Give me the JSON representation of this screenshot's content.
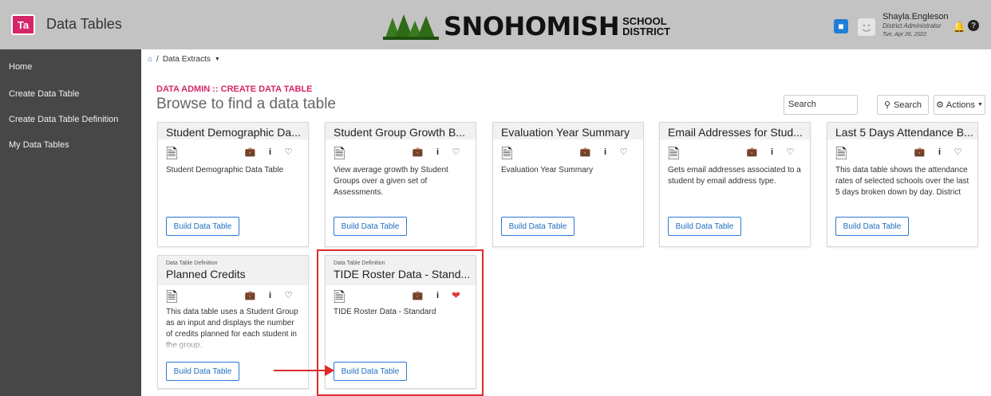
{
  "app": {
    "icon_text": "Ta",
    "title": "Data Tables"
  },
  "logo": {
    "name": "SNOHOMISH",
    "sub1": "SCHOOL",
    "sub2": "DISTRICT"
  },
  "user": {
    "name": "Shayla.Engleson",
    "role": "District Administrator",
    "date": "Tue, Apr 26, 2022"
  },
  "sidebar": {
    "items": [
      {
        "label": "Home"
      },
      {
        "label": "Create Data Table"
      },
      {
        "label": "Create Data Table Definition"
      },
      {
        "label": "My Data Tables"
      }
    ]
  },
  "breadcrumb": {
    "item": "Data Extracts"
  },
  "header": {
    "section": "DATA ADMIN :: CREATE DATA TABLE",
    "title": "Browse to find a data table"
  },
  "search": {
    "value": "Search",
    "button": "Search",
    "actions": "Actions"
  },
  "cards": [
    {
      "title": "Student Demographic Da...",
      "desc": "Student Demographic Data Table",
      "build": "Build Data Table"
    },
    {
      "title": "Student Group Growth B...",
      "desc": "View average growth by Student Groups over a given set of Assessments.",
      "build": "Build Data Table"
    },
    {
      "title": "Evaluation Year Summary",
      "desc": "Evaluation Year Summary",
      "build": "Build Data Table"
    },
    {
      "title": "Email Addresses for Stud...",
      "desc": "Gets email addresses associated to a student by email address type.",
      "build": "Build Data Table"
    },
    {
      "title": "Last 5 Days Attendance B...",
      "desc": "This data table shows the attendance rates of selected schools over the last 5 days broken down by day. District",
      "build": "Build Data Table"
    },
    {
      "kind": "Data Table Definition",
      "title": "Planned Credits",
      "desc": "This data table uses a Student Group as an input and displays the number of credits planned for each student in the group.",
      "build": "Build Data Table"
    },
    {
      "kind": "Data Table Definition",
      "title": "TIDE Roster Data - Stand...",
      "desc": "TIDE Roster Data - Standard",
      "build": "Build Data Table",
      "favorited": true
    }
  ],
  "colors": {
    "accent": "#d6266a",
    "link": "#1f6fbf",
    "highlight": "#e12a2a",
    "sidebar": "#474747",
    "topbar": "#c3c3c3"
  }
}
